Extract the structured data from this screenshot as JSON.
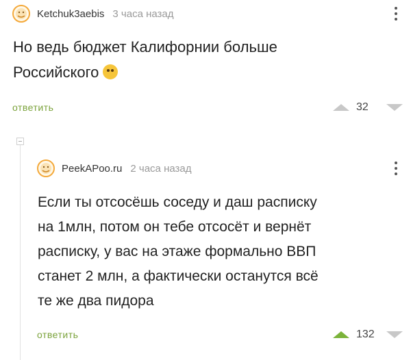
{
  "comments": [
    {
      "author": "Ketchuk3aebis",
      "time": "3 часа назад",
      "body_lines": [
        "Но ведь бюджет Калифорнии больше",
        "Российского"
      ],
      "reply_label": "ответить",
      "rating": "32",
      "emoji": "thinking-face"
    },
    {
      "author": "PeekAPoo.ru",
      "time": "2 часа назад",
      "body_lines": [
        "Если ты отсосёшь соседу и даш расписку",
        "на 1млн, потом он тебе отсосёт и вернёт",
        "расписку, у вас на этаже формально ВВП",
        "станет 2 млн, а фактически останутся всё",
        "те же два пидора"
      ],
      "reply_label": "ответить",
      "rating": "132"
    }
  ],
  "colors": {
    "reply_link": "#7aa23a",
    "upvote_active": "#7bb33a",
    "vote_inactive": "#c8c8c8",
    "avatar_ring": "#f4a93b"
  },
  "icons": [
    "avatar-icon",
    "more-icon",
    "upvote-icon",
    "downvote-icon",
    "collapse-icon",
    "thinking-emoji-icon"
  ]
}
